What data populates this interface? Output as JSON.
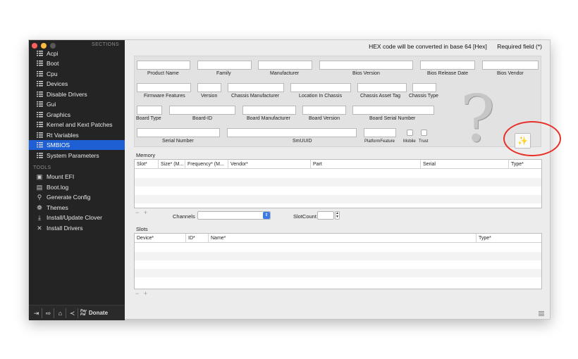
{
  "sidebar": {
    "sections_header": "SECTIONS",
    "items": [
      {
        "label": "Acpi"
      },
      {
        "label": "Boot"
      },
      {
        "label": "Cpu"
      },
      {
        "label": "Devices"
      },
      {
        "label": "Disable Drivers"
      },
      {
        "label": "Gui"
      },
      {
        "label": "Graphics"
      },
      {
        "label": "Kernel and Kext Patches"
      },
      {
        "label": "Rt Variables"
      },
      {
        "label": "SMBIOS"
      },
      {
        "label": "System Parameters"
      }
    ],
    "selected": "SMBIOS",
    "tools_header": "TOOLS",
    "tools": [
      {
        "label": "Mount EFI",
        "icon": "disk-icon"
      },
      {
        "label": "Boot.log",
        "icon": "document-icon"
      },
      {
        "label": "Generate Config",
        "icon": "magnifier-icon"
      },
      {
        "label": "Themes",
        "icon": "palette-icon"
      },
      {
        "label": "Install/Update Clover",
        "icon": "download-icon"
      },
      {
        "label": "Install Drivers",
        "icon": "tools-icon"
      }
    ],
    "bottom": {
      "donate_label": "Donate",
      "paypal_top": "Pay",
      "paypal_bottom": "Pal"
    }
  },
  "header": {
    "hex_note": "HEX code will be converted in base 64 [Hex]",
    "required_note": "Required field (*)"
  },
  "smbios": {
    "product_name": {
      "label": "Product Name",
      "value": ""
    },
    "family": {
      "label": "Family",
      "value": ""
    },
    "manufacturer": {
      "label": "Manufacturer",
      "value": ""
    },
    "bios_version": {
      "label": "Bios Version",
      "value": ""
    },
    "bios_release_date": {
      "label": "Bios Release Date",
      "value": ""
    },
    "bios_vendor": {
      "label": "Bios Vendor",
      "value": ""
    },
    "firmware_features": {
      "label": "Firmware Features",
      "value": ""
    },
    "version": {
      "label": "Version",
      "value": ""
    },
    "chassis_manufacturer": {
      "label": "Chassis Manufacturer",
      "value": ""
    },
    "location_in_chassis": {
      "label": "Location In Chassis",
      "value": ""
    },
    "chassis_asset_tag": {
      "label": "Chassis  Asset Tag",
      "value": ""
    },
    "chassis_type": {
      "label": "Chassis Type",
      "value": ""
    },
    "board_type": {
      "label": "Board Type",
      "value": ""
    },
    "board_id": {
      "label": "Board-ID",
      "value": ""
    },
    "board_manufacturer": {
      "label": "Board Manufacturer",
      "value": ""
    },
    "board_version": {
      "label": "Board Version",
      "value": ""
    },
    "board_serial_number": {
      "label": "Board Serial Number",
      "value": ""
    },
    "serial_number": {
      "label": "Serial Number",
      "value": ""
    },
    "smuuid": {
      "label": "SmUUID",
      "value": ""
    },
    "platform_feature": {
      "label": "PlatformFeature",
      "value": ""
    },
    "mobile": {
      "label": "Mobile",
      "checked": false
    },
    "trust": {
      "label": "Trust",
      "checked": false
    }
  },
  "memory": {
    "title": "Memory",
    "columns": [
      "Slot*",
      "Size* (M...",
      "Frequency* (M...",
      "Vendor*",
      "Part",
      "Serial",
      "Type*"
    ],
    "rows": [],
    "add_remove": "− +",
    "channels_label": "Channels",
    "channels_value": "",
    "slotcount_label": "SlotCount",
    "slotcount_value": ""
  },
  "slots": {
    "title": "Slots",
    "columns": [
      "Device*",
      "ID*",
      "Name*",
      "Type*"
    ],
    "rows": [],
    "add_remove": "− +"
  },
  "colors": {
    "selection": "#1e5fd3",
    "sidebar_bg": "#242424",
    "highlight_ring": "#e8302a"
  }
}
